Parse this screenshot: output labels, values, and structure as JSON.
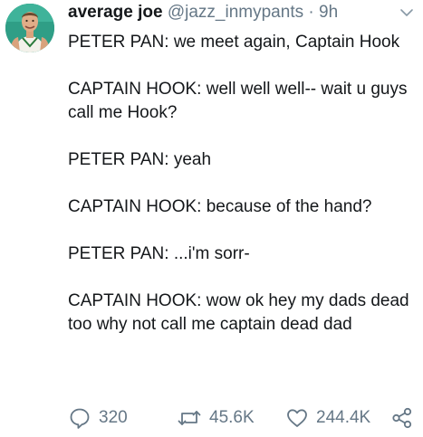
{
  "tweet": {
    "author": {
      "display_name": "average joe",
      "handle": "@jazz_inmypants",
      "separator": "·",
      "time": "9h",
      "avatar": "avatar-photo"
    },
    "menu_icon": "chevron-down-icon",
    "lines": [
      "PETER PAN: we meet again, Captain Hook",
      "CAPTAIN HOOK: well well well-- wait u guys call me Hook?",
      "PETER PAN: yeah",
      "CAPTAIN HOOK: because of the hand?",
      "PETER PAN: ...i'm sorr-",
      "CAPTAIN HOOK: wow ok hey my dads dead too why not call me captain dead dad"
    ],
    "actions": {
      "replies": {
        "icon": "reply-icon",
        "count": "320"
      },
      "retweets": {
        "icon": "retweet-icon",
        "count": "45.6K"
      },
      "likes": {
        "icon": "heart-icon",
        "count": "244.4K"
      },
      "share": {
        "icon": "share-icon"
      }
    },
    "colors": {
      "text": "#14171a",
      "secondary": "#657786",
      "background": "#ffffff"
    }
  }
}
